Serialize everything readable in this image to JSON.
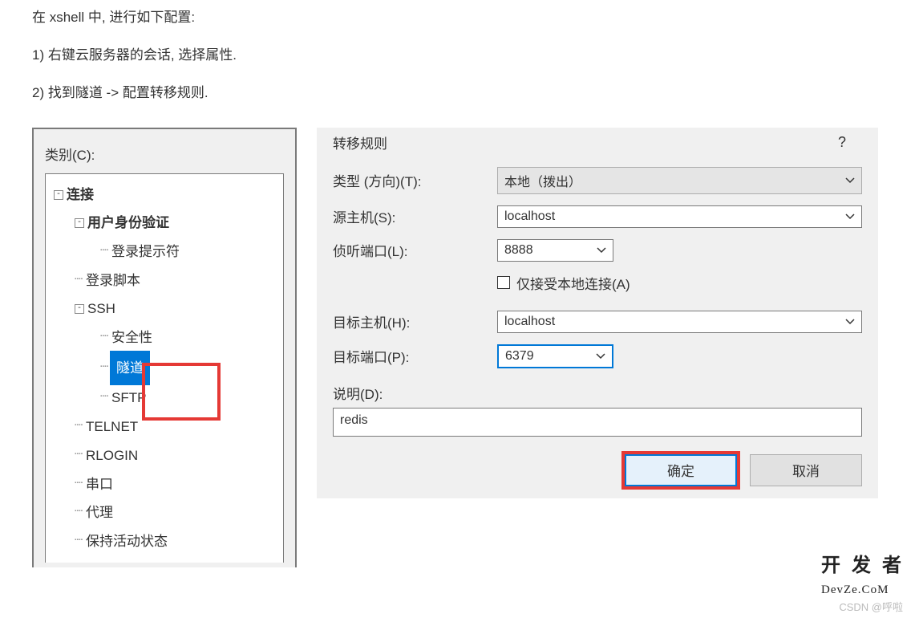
{
  "intro": {
    "line1": "在 xshell 中, 进行如下配置:",
    "line2": "1) 右键云服务器的会话, 选择属性.",
    "line3": "2) 找到隧道 -> 配置转移规则."
  },
  "tree": {
    "category_label": "类别(C):",
    "items": {
      "connection": "连接",
      "auth": "用户身份验证",
      "login_prompt": "登录提示符",
      "login_script": "登录脚本",
      "ssh": "SSH",
      "security": "安全性",
      "tunnel": "隧道",
      "sftp": "SFTP",
      "telnet": "TELNET",
      "rlogin": "RLOGIN",
      "serial": "串口",
      "proxy": "代理",
      "keep_alive": "保持活动状态"
    }
  },
  "dialog": {
    "title": "转移规则",
    "type_label": "类型 (方向)(T):",
    "type_value": "本地（拨出）",
    "source_label": "源主机(S):",
    "source_value": "localhost",
    "listen_port_label": "侦听端口(L):",
    "listen_port_value": "8888",
    "local_only_label": "仅接受本地连接(A)",
    "target_host_label": "目标主机(H):",
    "target_host_value": "localhost",
    "target_port_label": "目标端口(P):",
    "target_port_value": "6379",
    "desc_label": "说明(D):",
    "desc_value": "redis",
    "ok_label": "确定",
    "cancel_label": "取消"
  },
  "watermark": {
    "csdn": "CSDN @呼啦",
    "brand": "开 发 者",
    "brand_sub": "DevZe.CoM"
  }
}
